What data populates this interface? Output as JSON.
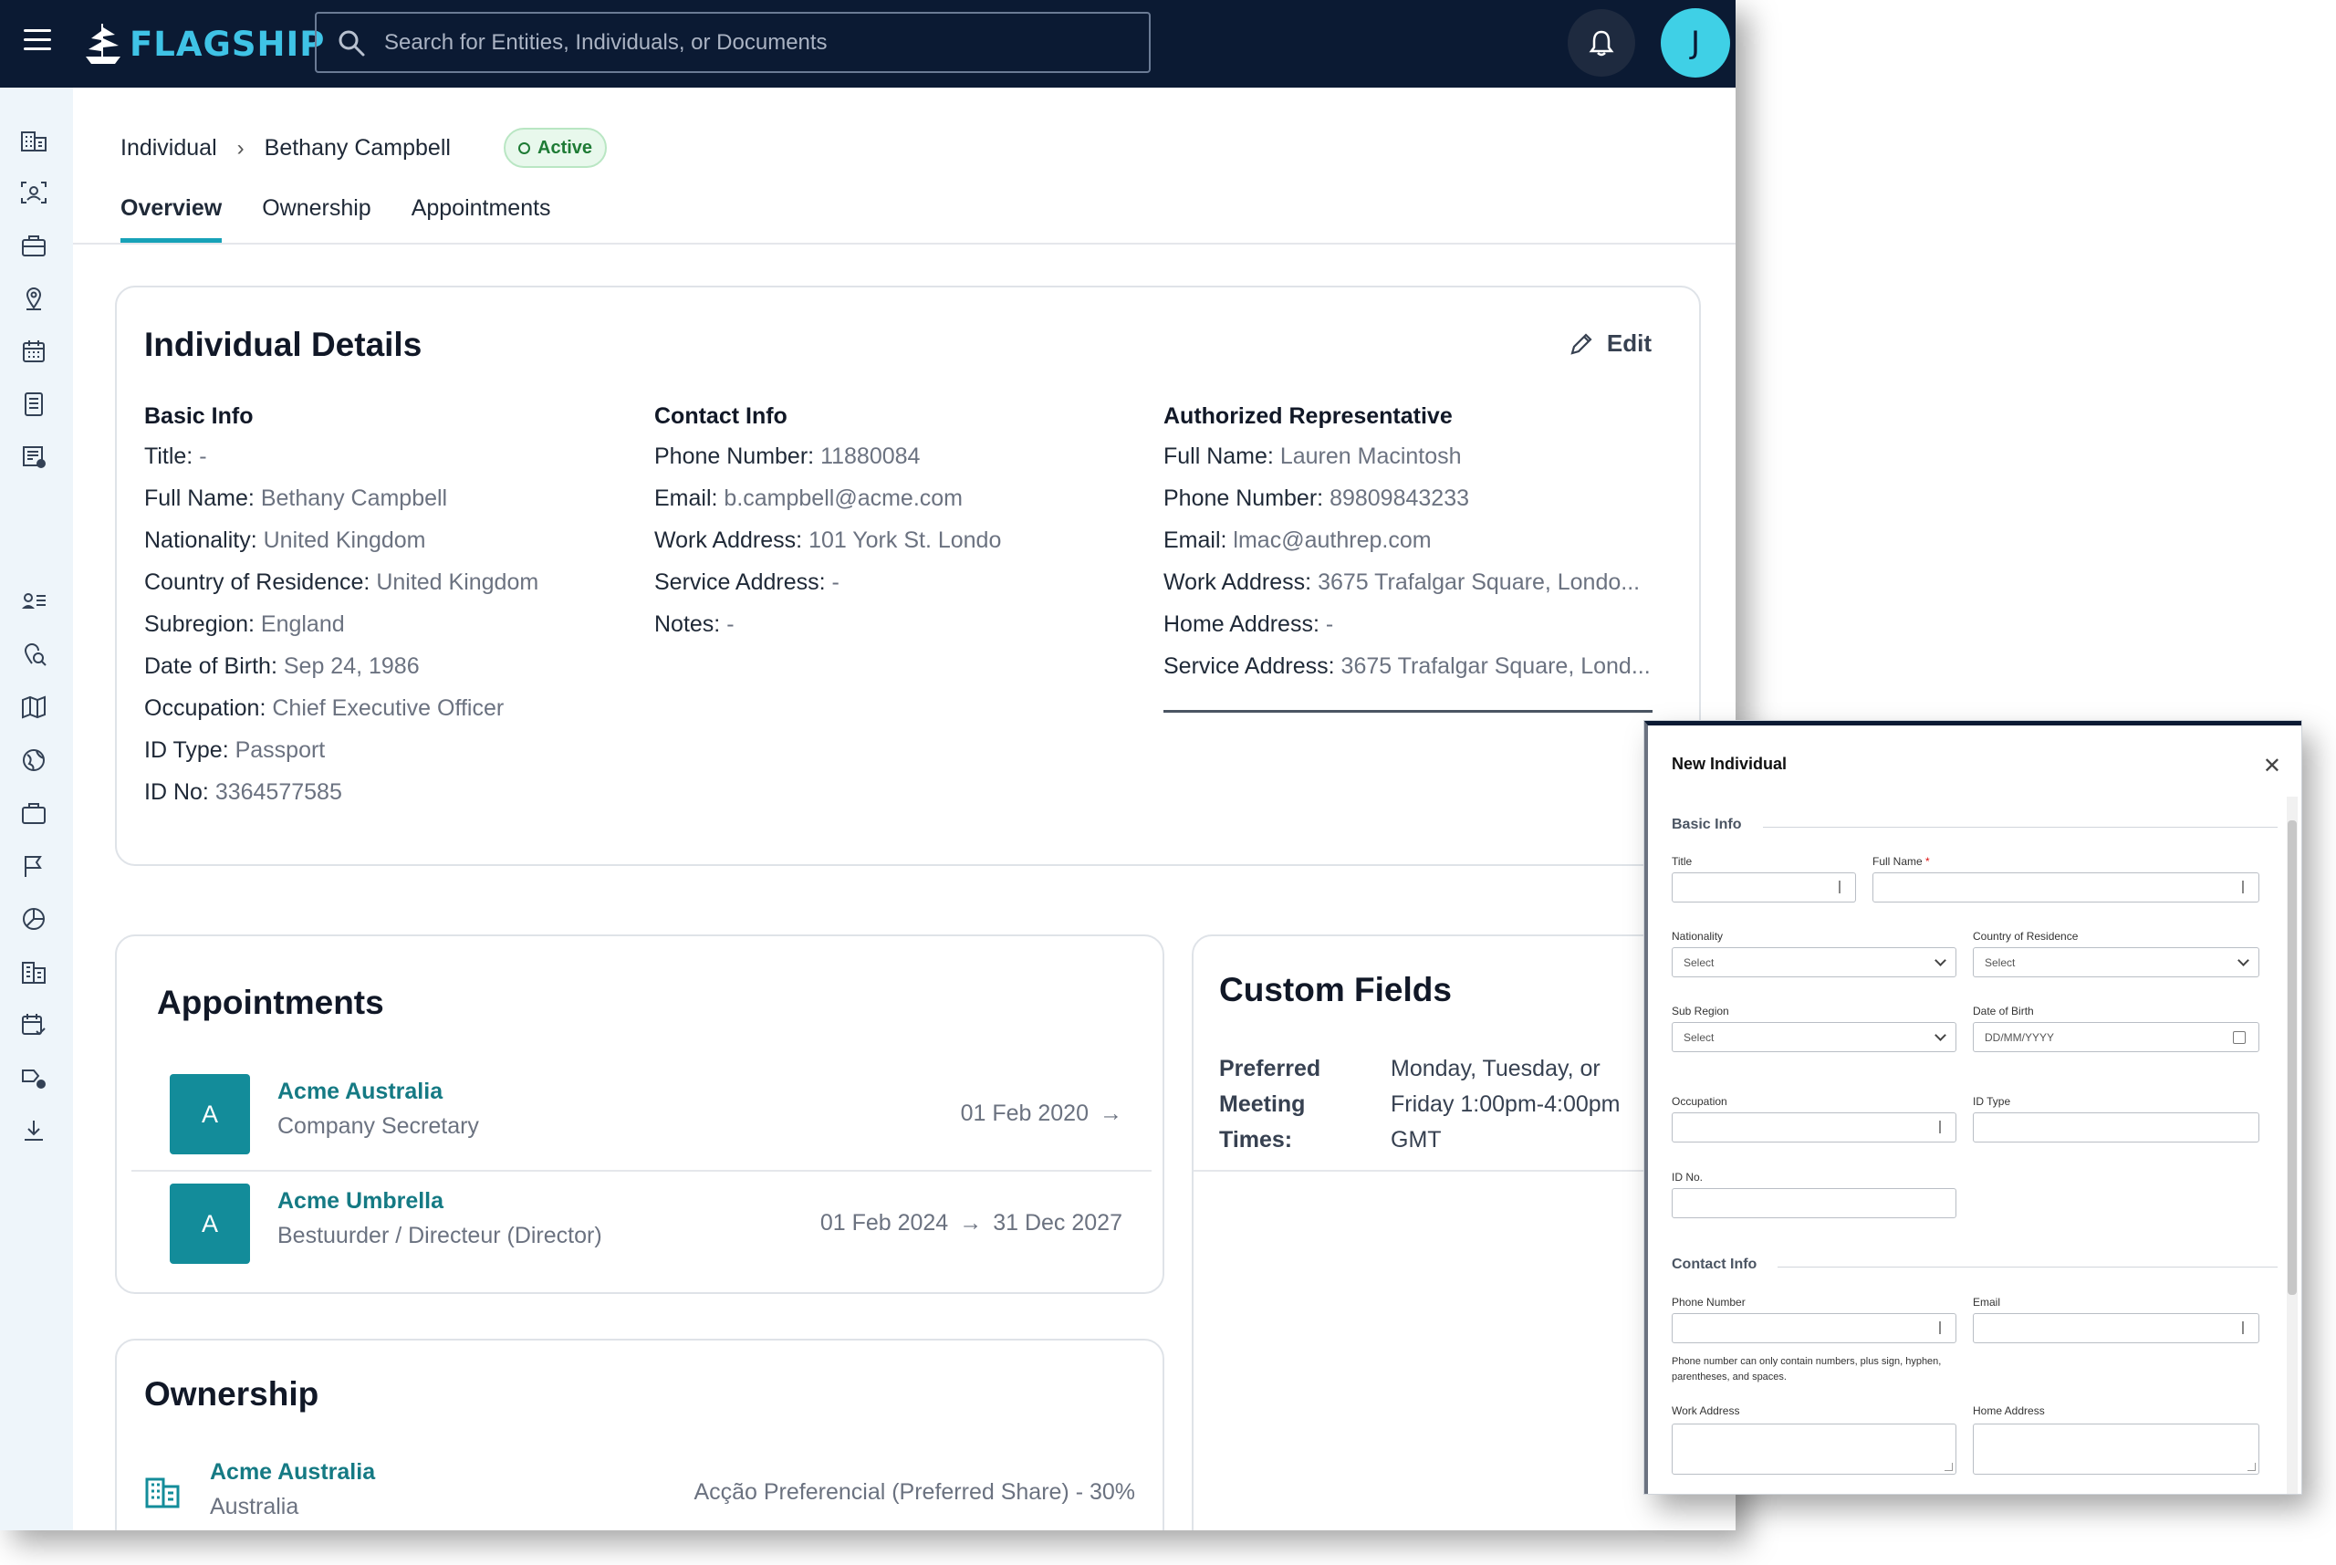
{
  "app": {
    "brand": "FLAGSHIP",
    "search_placeholder": "Search for Entities, Individuals, or Documents",
    "user_initial": "J"
  },
  "sidebar_icons": [
    "entities-icon",
    "individuals-icon",
    "briefcase-icon",
    "location-icon",
    "calendar-icon",
    "documents-icon",
    "reports-icon",
    "contacts-list-icon",
    "pin-search-icon",
    "map-icon",
    "globe-icon",
    "portfolio-icon",
    "flag-icon",
    "chart-pie-icon",
    "buildings-icon",
    "calendar-check-icon",
    "workflow-icon",
    "download-icon"
  ],
  "breadcrumb": {
    "parent": "Individual",
    "current": "Bethany Campbell"
  },
  "status": {
    "label": "Active",
    "color": "#1e7b35"
  },
  "tabs": [
    "Overview",
    "Ownership",
    "Appointments"
  ],
  "details": {
    "title": "Individual Details",
    "edit_label": "Edit",
    "basic": {
      "heading": "Basic Info",
      "rows": [
        {
          "k": "Title:",
          "v": "-"
        },
        {
          "k": "Full Name:",
          "v": "Bethany Campbell"
        },
        {
          "k": "Nationality:",
          "v": "United Kingdom"
        },
        {
          "k": "Country of Residence:",
          "v": "United Kingdom"
        },
        {
          "k": "Subregion:",
          "v": "England"
        },
        {
          "k": "Date of Birth:",
          "v": "Sep 24, 1986"
        },
        {
          "k": "Occupation:",
          "v": "Chief Executive Officer"
        },
        {
          "k": "ID Type:",
          "v": "Passport"
        },
        {
          "k": "ID No:",
          "v": "3364577585"
        }
      ]
    },
    "contact": {
      "heading": "Contact Info",
      "rows": [
        {
          "k": "Phone Number:",
          "v": "11880084"
        },
        {
          "k": "Email:",
          "v": "b.campbell@acme.com"
        },
        {
          "k": "Work Address:",
          "v": "101 York St. Londo"
        },
        {
          "k": "Service Address:",
          "v": "-"
        },
        {
          "k": "Notes:",
          "v": "-"
        }
      ]
    },
    "rep": {
      "heading": "Authorized Representative",
      "rows": [
        {
          "k": "Full Name:",
          "v": "Lauren Macintosh"
        },
        {
          "k": "Phone Number:",
          "v": "89809843233"
        },
        {
          "k": "Email:",
          "v": "lmac@authrep.com"
        },
        {
          "k": "Work Address:",
          "v": "3675 Trafalgar Square, Londo..."
        },
        {
          "k": "Home Address:",
          "v": "-"
        },
        {
          "k": "Service Address:",
          "v": "3675 Trafalgar Square, Lond..."
        }
      ]
    }
  },
  "appointments": {
    "title": "Appointments",
    "items": [
      {
        "initial": "A",
        "name": "Acme Australia",
        "role": "Company Secretary",
        "start": "01 Feb 2020",
        "end": ""
      },
      {
        "initial": "A",
        "name": "Acme Umbrella",
        "role": "Bestuurder / Directeur (Director)",
        "start": "01 Feb 2024",
        "end": "31 Dec 2027"
      }
    ]
  },
  "custom_fields": {
    "title": "Custom Fields",
    "label_lines": [
      "Preferred",
      "Meeting",
      "Times:"
    ],
    "value_lines": [
      "Monday, Tuesday, or",
      "Friday 1:00pm-4:00pm",
      "GMT"
    ]
  },
  "ownership": {
    "title": "Ownership",
    "items": [
      {
        "name": "Acme Australia",
        "country": "Australia",
        "share": "Acção Preferencial (Preferred Share) - 30%"
      }
    ]
  },
  "dialog": {
    "title": "New Individual",
    "basic_section": "Basic Info",
    "contact_section": "Contact Info",
    "labels": {
      "title": "Title",
      "full_name": "Full Name",
      "nationality": "Nationality",
      "country": "Country of Residence",
      "sub_region": "Sub Region",
      "dob": "Date of Birth",
      "occupation": "Occupation",
      "id_type": "ID Type",
      "id_no": "ID No.",
      "phone": "Phone Number",
      "email": "Email",
      "work_address": "Work Address",
      "home_address": "Home Address"
    },
    "required_mark": "*",
    "select_placeholder": "Select",
    "date_placeholder": "DD/MM/YYYY",
    "phone_hint": "Phone number can only contain numbers, plus sign, hyphen, parentheses, and spaces."
  }
}
